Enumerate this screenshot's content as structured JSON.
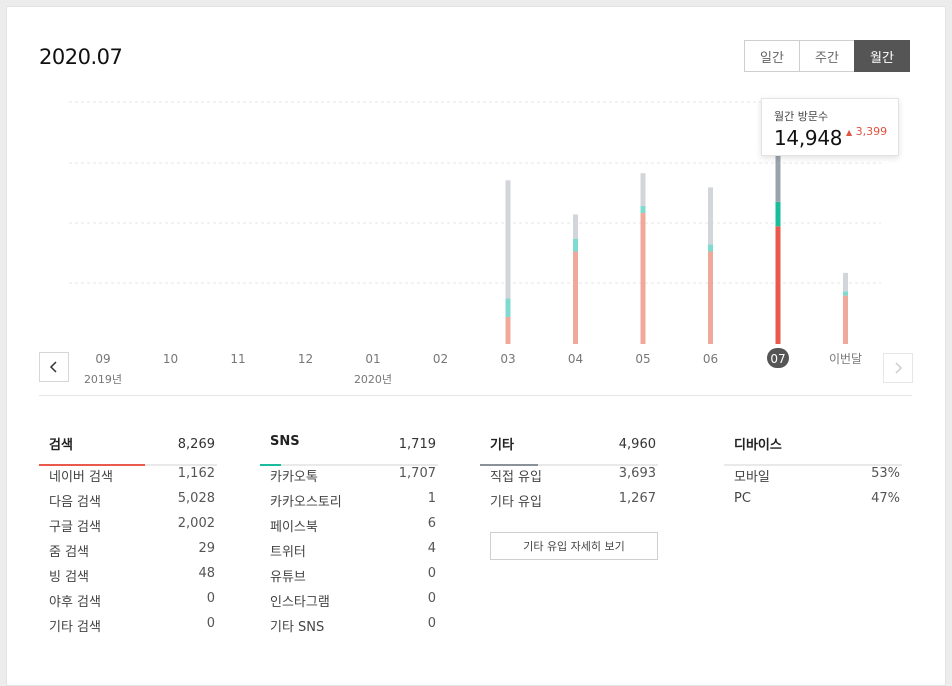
{
  "header": {
    "period": "2020.07"
  },
  "toggle": {
    "daily": "일간",
    "weekly": "주간",
    "monthly": "월간"
  },
  "chart_data": {
    "type": "bar",
    "stacked": true,
    "categories": [
      "09",
      "10",
      "11",
      "12",
      "01",
      "02",
      "03",
      "04",
      "05",
      "06",
      "07",
      "이번달"
    ],
    "year_labels": [
      "2019년",
      "2020년"
    ],
    "series": [
      {
        "color": "#f0a89a",
        "highlight_color": "#ea5a4c",
        "values": [
          0,
          0,
          0,
          0,
          0,
          0,
          1900,
          6500,
          9200,
          6500,
          8269,
          3400
        ]
      },
      {
        "color": "#7fdbd0",
        "highlight_color": "#1abc9c",
        "values": [
          0,
          0,
          0,
          0,
          0,
          0,
          1300,
          900,
          500,
          500,
          1719,
          300
        ]
      },
      {
        "color": "#d2d6db",
        "highlight_color": "#9aa3ac",
        "values": [
          0,
          0,
          0,
          0,
          0,
          0,
          8300,
          1700,
          2300,
          4000,
          4960,
          1300
        ]
      }
    ],
    "selected_index": 10,
    "ylim": [
      0,
      17000
    ],
    "grid": true
  },
  "tooltip": {
    "label": "월간 방문수",
    "value": "14,948",
    "delta": "3,399"
  },
  "sections": [
    {
      "title": "검색",
      "total": "8,269",
      "accent": "#ea5a4c",
      "rows": [
        {
          "label": "네이버 검색",
          "value": "1,162"
        },
        {
          "label": "다음 검색",
          "value": "5,028"
        },
        {
          "label": "구글 검색",
          "value": "2,002"
        },
        {
          "label": "줌 검색",
          "value": "29"
        },
        {
          "label": "빙 검색",
          "value": "48"
        },
        {
          "label": "야후 검색",
          "value": "0"
        },
        {
          "label": "기타 검색",
          "value": "0"
        }
      ]
    },
    {
      "title": "SNS",
      "total": "1,719",
      "accent": "#1abc9c",
      "rows": [
        {
          "label": "카카오톡",
          "value": "1,707"
        },
        {
          "label": "카카오스토리",
          "value": "1"
        },
        {
          "label": "페이스북",
          "value": "6"
        },
        {
          "label": "트위터",
          "value": "4"
        },
        {
          "label": "유튜브",
          "value": "0"
        },
        {
          "label": "인스타그램",
          "value": "0"
        },
        {
          "label": "기타 SNS",
          "value": "0"
        }
      ]
    },
    {
      "title": "기타",
      "total": "4,960",
      "accent": "#8a9199",
      "rows": [
        {
          "label": "직접 유입",
          "value": "3,693"
        },
        {
          "label": "기타 유입",
          "value": "1,267"
        }
      ],
      "button": "기타 유입 자세히 보기"
    },
    {
      "title": "디바이스",
      "total": "",
      "rows": [
        {
          "label": "모바일",
          "value": "53%"
        },
        {
          "label": "PC",
          "value": "47%"
        }
      ]
    }
  ],
  "icons": {
    "prev": "chevron-left-icon",
    "next": "chevron-right-icon",
    "delta": "up-triangle-icon"
  }
}
